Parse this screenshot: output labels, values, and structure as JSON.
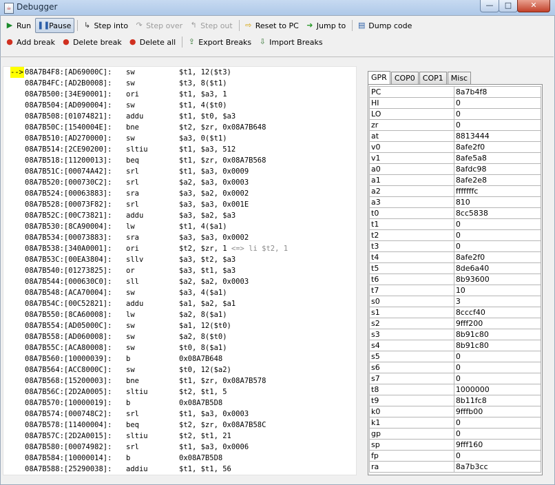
{
  "window": {
    "title": "Debugger",
    "minimize": "—",
    "maximize": "□",
    "close": "✕"
  },
  "toolbar1": [
    {
      "label": "Run",
      "icon": "play-icon",
      "glyph": "▶",
      "color": "#1a8a2a",
      "state": "normal"
    },
    {
      "label": "Pause",
      "icon": "pause-icon",
      "glyph": "❚❚",
      "color": "#2c5fa8",
      "state": "pressed"
    },
    {
      "sep": true
    },
    {
      "label": "Step into",
      "icon": "step-into-icon",
      "glyph": "↳",
      "color": "#333333",
      "state": "normal"
    },
    {
      "label": "Step over",
      "icon": "step-over-icon",
      "glyph": "↷",
      "color": "#9c9c9c",
      "state": "disabled"
    },
    {
      "label": "Step out",
      "icon": "step-out-icon",
      "glyph": "↰",
      "color": "#9c9c9c",
      "state": "disabled"
    },
    {
      "sep": true
    },
    {
      "label": "Reset to PC",
      "icon": "arrow-right-icon",
      "glyph": "⇨",
      "color": "#d4a100",
      "state": "normal"
    },
    {
      "label": "Jump to",
      "icon": "jump-icon",
      "glyph": "➜",
      "color": "#2a9a2a",
      "state": "normal"
    },
    {
      "sep": true
    },
    {
      "label": "Dump code",
      "icon": "dump-icon",
      "glyph": "▤",
      "color": "#2c5fa8",
      "state": "normal"
    }
  ],
  "toolbar2": [
    {
      "label": "Add break",
      "icon": "add-break-icon",
      "glyph": "●",
      "color": "#d03020",
      "state": "normal"
    },
    {
      "label": "Delete break",
      "icon": "delete-break-icon",
      "glyph": "●",
      "color": "#d03020",
      "state": "normal"
    },
    {
      "label": "Delete all",
      "icon": "delete-all-icon",
      "glyph": "●",
      "color": "#d03020",
      "state": "normal"
    },
    {
      "sep": true
    },
    {
      "label": "Export Breaks",
      "icon": "export-icon",
      "glyph": "⇪",
      "color": "#3a7a3a",
      "state": "normal"
    },
    {
      "label": "Import Breaks",
      "icon": "import-icon",
      "glyph": "⇩",
      "color": "#3a7a3a",
      "state": "normal"
    }
  ],
  "disassembly": {
    "current_marker": "-->",
    "lines": [
      {
        "addr": "08A7B4F8:[AD69000C]:",
        "op": "sw",
        "args": "$t1, 12($t3)",
        "cmt": "",
        "current": true
      },
      {
        "addr": "08A7B4FC:[AD2B0008]:",
        "op": "sw",
        "args": "$t3, 8($t1)",
        "cmt": ""
      },
      {
        "addr": "08A7B500:[34E90001]:",
        "op": "ori",
        "args": "$t1, $a3, 1",
        "cmt": ""
      },
      {
        "addr": "08A7B504:[AD090004]:",
        "op": "sw",
        "args": "$t1, 4($t0)",
        "cmt": ""
      },
      {
        "addr": "08A7B508:[01074821]:",
        "op": "addu",
        "args": "$t1, $t0, $a3",
        "cmt": ""
      },
      {
        "addr": "08A7B50C:[1540004E]:",
        "op": "bne",
        "args": "$t2, $zr, 0x08A7B648",
        "cmt": ""
      },
      {
        "addr": "08A7B510:[AD270000]:",
        "op": "sw",
        "args": "$a3, 0($t1)",
        "cmt": ""
      },
      {
        "addr": "08A7B514:[2CE90200]:",
        "op": "sltiu",
        "args": "$t1, $a3, 512",
        "cmt": ""
      },
      {
        "addr": "08A7B518:[11200013]:",
        "op": "beq",
        "args": "$t1, $zr, 0x08A7B568",
        "cmt": ""
      },
      {
        "addr": "08A7B51C:[00074A42]:",
        "op": "srl",
        "args": "$t1, $a3, 0x0009",
        "cmt": ""
      },
      {
        "addr": "08A7B520:[000730C2]:",
        "op": "srl",
        "args": "$a2, $a3, 0x0003",
        "cmt": ""
      },
      {
        "addr": "08A7B524:[00063883]:",
        "op": "sra",
        "args": "$a3, $a2, 0x0002",
        "cmt": ""
      },
      {
        "addr": "08A7B528:[00073F82]:",
        "op": "srl",
        "args": "$a3, $a3, 0x001E",
        "cmt": ""
      },
      {
        "addr": "08A7B52C:[00C73821]:",
        "op": "addu",
        "args": "$a3, $a2, $a3",
        "cmt": ""
      },
      {
        "addr": "08A7B530:[8CA90004]:",
        "op": "lw",
        "args": "$t1, 4($a1)",
        "cmt": ""
      },
      {
        "addr": "08A7B534:[00073883]:",
        "op": "sra",
        "args": "$a3, $a3, 0x0002",
        "cmt": ""
      },
      {
        "addr": "08A7B538:[340A0001]:",
        "op": "ori",
        "args": "$t2, $zr, 1",
        "cmt": " <=> li $t2, 1"
      },
      {
        "addr": "08A7B53C:[00EA3804]:",
        "op": "sllv",
        "args": "$a3, $t2, $a3",
        "cmt": ""
      },
      {
        "addr": "08A7B540:[01273825]:",
        "op": "or",
        "args": "$a3, $t1, $a3",
        "cmt": ""
      },
      {
        "addr": "08A7B544:[000630C0]:",
        "op": "sll",
        "args": "$a2, $a2, 0x0003",
        "cmt": ""
      },
      {
        "addr": "08A7B548:[ACA70004]:",
        "op": "sw",
        "args": "$a3, 4($a1)",
        "cmt": ""
      },
      {
        "addr": "08A7B54C:[00C52821]:",
        "op": "addu",
        "args": "$a1, $a2, $a1",
        "cmt": ""
      },
      {
        "addr": "08A7B550:[8CA60008]:",
        "op": "lw",
        "args": "$a2, 8($a1)",
        "cmt": ""
      },
      {
        "addr": "08A7B554:[AD05000C]:",
        "op": "sw",
        "args": "$a1, 12($t0)",
        "cmt": ""
      },
      {
        "addr": "08A7B558:[AD060008]:",
        "op": "sw",
        "args": "$a2, 8($t0)",
        "cmt": ""
      },
      {
        "addr": "08A7B55C:[ACA80008]:",
        "op": "sw",
        "args": "$t0, 8($a1)",
        "cmt": ""
      },
      {
        "addr": "08A7B560:[10000039]:",
        "op": "b",
        "args": "0x08A7B648",
        "cmt": ""
      },
      {
        "addr": "08A7B564:[ACC8000C]:",
        "op": "sw",
        "args": "$t0, 12($a2)",
        "cmt": ""
      },
      {
        "addr": "08A7B568:[15200003]:",
        "op": "bne",
        "args": "$t1, $zr, 0x08A7B578",
        "cmt": ""
      },
      {
        "addr": "08A7B56C:[2D2A0005]:",
        "op": "sltiu",
        "args": "$t2, $t1, 5",
        "cmt": ""
      },
      {
        "addr": "08A7B570:[10000019]:",
        "op": "b",
        "args": "0x08A7B5D8",
        "cmt": ""
      },
      {
        "addr": "08A7B574:[000748C2]:",
        "op": "srl",
        "args": "$t1, $a3, 0x0003",
        "cmt": ""
      },
      {
        "addr": "08A7B578:[11400004]:",
        "op": "beq",
        "args": "$t2, $zr, 0x08A7B58C",
        "cmt": ""
      },
      {
        "addr": "08A7B57C:[2D2A0015]:",
        "op": "sltiu",
        "args": "$t2, $t1, 21",
        "cmt": ""
      },
      {
        "addr": "08A7B580:[00074982]:",
        "op": "srl",
        "args": "$t1, $a3, 0x0006",
        "cmt": ""
      },
      {
        "addr": "08A7B584:[10000014]:",
        "op": "b",
        "args": "0x08A7B5D8",
        "cmt": ""
      },
      {
        "addr": "08A7B588:[25290038]:",
        "op": "addiu",
        "args": "$t1, $t1, 56",
        "cmt": ""
      }
    ]
  },
  "register_tabs": [
    {
      "label": "GPR",
      "active": true
    },
    {
      "label": "COP0",
      "active": false
    },
    {
      "label": "COP1",
      "active": false
    },
    {
      "label": "Misc",
      "active": false
    }
  ],
  "registers": [
    {
      "name": "PC",
      "value": "8a7b4f8"
    },
    {
      "name": "HI",
      "value": "0"
    },
    {
      "name": "LO",
      "value": "0"
    },
    {
      "name": "zr",
      "value": "0"
    },
    {
      "name": "at",
      "value": "8813444"
    },
    {
      "name": "v0",
      "value": "8afe2f0"
    },
    {
      "name": "v1",
      "value": "8afe5a8"
    },
    {
      "name": "a0",
      "value": "8afdc98"
    },
    {
      "name": "a1",
      "value": "8afe2e8"
    },
    {
      "name": "a2",
      "value": "fffffffc"
    },
    {
      "name": "a3",
      "value": "810"
    },
    {
      "name": "t0",
      "value": "8cc5838"
    },
    {
      "name": "t1",
      "value": "0"
    },
    {
      "name": "t2",
      "value": "0"
    },
    {
      "name": "t3",
      "value": "0"
    },
    {
      "name": "t4",
      "value": "8afe2f0"
    },
    {
      "name": "t5",
      "value": "8de6a40"
    },
    {
      "name": "t6",
      "value": "8b93600"
    },
    {
      "name": "t7",
      "value": "10"
    },
    {
      "name": "s0",
      "value": "3"
    },
    {
      "name": "s1",
      "value": "8cccf40"
    },
    {
      "name": "s2",
      "value": "9fff200"
    },
    {
      "name": "s3",
      "value": "8b91c80"
    },
    {
      "name": "s4",
      "value": "8b91c80"
    },
    {
      "name": "s5",
      "value": "0"
    },
    {
      "name": "s6",
      "value": "0"
    },
    {
      "name": "s7",
      "value": "0"
    },
    {
      "name": "t8",
      "value": "1000000"
    },
    {
      "name": "t9",
      "value": "8b11fc8"
    },
    {
      "name": "k0",
      "value": "9fffb00"
    },
    {
      "name": "k1",
      "value": "0"
    },
    {
      "name": "gp",
      "value": "0"
    },
    {
      "name": "sp",
      "value": "9fff160"
    },
    {
      "name": "fp",
      "value": "0"
    },
    {
      "name": "ra",
      "value": "8a7b3cc"
    }
  ]
}
